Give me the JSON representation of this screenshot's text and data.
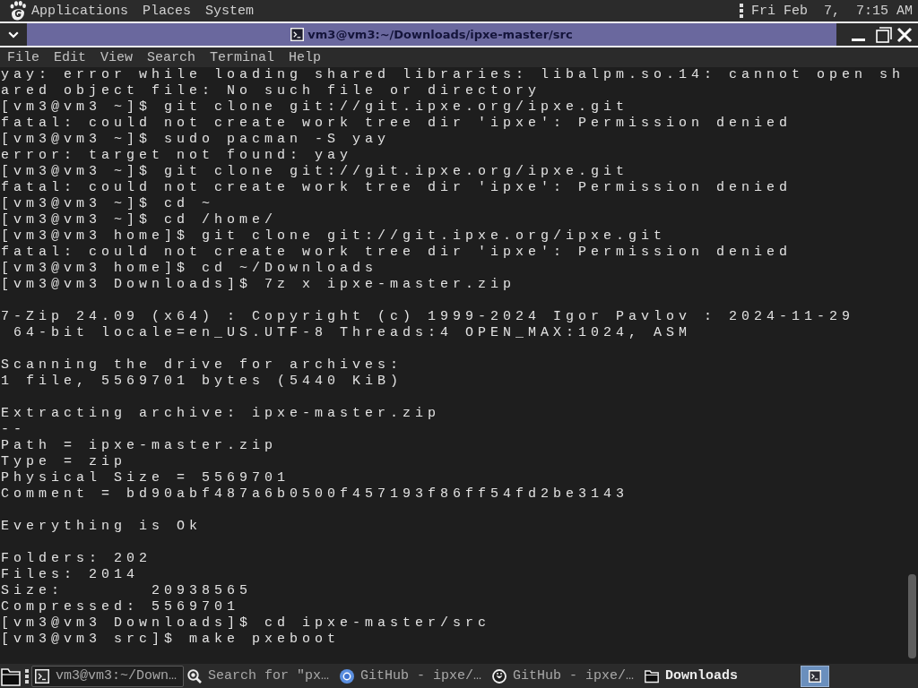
{
  "top_panel": {
    "menus": [
      "Applications",
      "Places",
      "System"
    ],
    "clock": "Fri Feb  7,  7:15 AM"
  },
  "window": {
    "title": "vm3@vm3:~/Downloads/ipxe-master/src"
  },
  "menubar": [
    "File",
    "Edit",
    "View",
    "Search",
    "Terminal",
    "Help"
  ],
  "terminal": {
    "blocks": [
      {
        "lines": [
          "yay: error while loading shared libraries: libalpm.so.14: cannot open sh",
          "ared object file: No such file or directory",
          "[vm3@vm3 ~]$ git clone git://git.ipxe.org/ipxe.git",
          "fatal: could not create work tree dir 'ipxe': Permission denied",
          "[vm3@vm3 ~]$ sudo pacman -S yay",
          "error: target not found: yay",
          "[vm3@vm3 ~]$ git clone git://git.ipxe.org/ipxe.git",
          "fatal: could not create work tree dir 'ipxe': Permission denied",
          "[vm3@vm3 ~]$ cd ~",
          "[vm3@vm3 ~]$ cd /home/",
          "[vm3@vm3 home]$ git clone git://git.ipxe.org/ipxe.git",
          "fatal: could not create work tree dir 'ipxe': Permission denied",
          "[vm3@vm3 home]$ cd ~/Downloads",
          "[vm3@vm3 Downloads]$ 7z x ipxe-master.zip"
        ]
      },
      {
        "lines": [
          "7-Zip 24.09 (x64) : Copyright (c) 1999-2024 Igor Pavlov : 2024-11-29",
          " 64-bit locale=en_US.UTF-8 Threads:4 OPEN_MAX:1024, ASM"
        ]
      },
      {
        "lines": [
          "Scanning the drive for archives:",
          "1 file, 5569701 bytes (5440 KiB)"
        ]
      },
      {
        "lines": [
          "Extracting archive: ipxe-master.zip",
          "--",
          "Path = ipxe-master.zip",
          "Type = zip",
          "Physical Size = 5569701",
          "Comment = bd90abf487a6b0500f457193f86ff54fd2be3143"
        ]
      },
      {
        "lines": [
          "Everything is Ok"
        ]
      },
      {
        "lines": [
          "Folders: 202",
          "Files: 2014",
          "Size:       20938565",
          "Compressed: 5569701",
          "[vm3@vm3 Downloads]$ cd ipxe-master/src",
          "[vm3@vm3 src]$ make pxeboot"
        ]
      }
    ]
  },
  "taskbar": {
    "tasks": [
      {
        "label": "vm3@vm3:~/Down…",
        "kind": "terminal",
        "selected": true,
        "attention": false
      },
      {
        "label": "Search for \"px…",
        "kind": "search",
        "selected": false,
        "attention": false
      },
      {
        "label": "GitHub - ipxe/…",
        "kind": "target",
        "selected": false,
        "attention": false
      },
      {
        "label": "GitHub - ipxe/…",
        "kind": "smiley",
        "selected": false,
        "attention": false
      },
      {
        "label": "Downloads",
        "kind": "folder",
        "selected": false,
        "attention": true
      }
    ],
    "workspaces": [
      {
        "selected": true
      }
    ]
  }
}
